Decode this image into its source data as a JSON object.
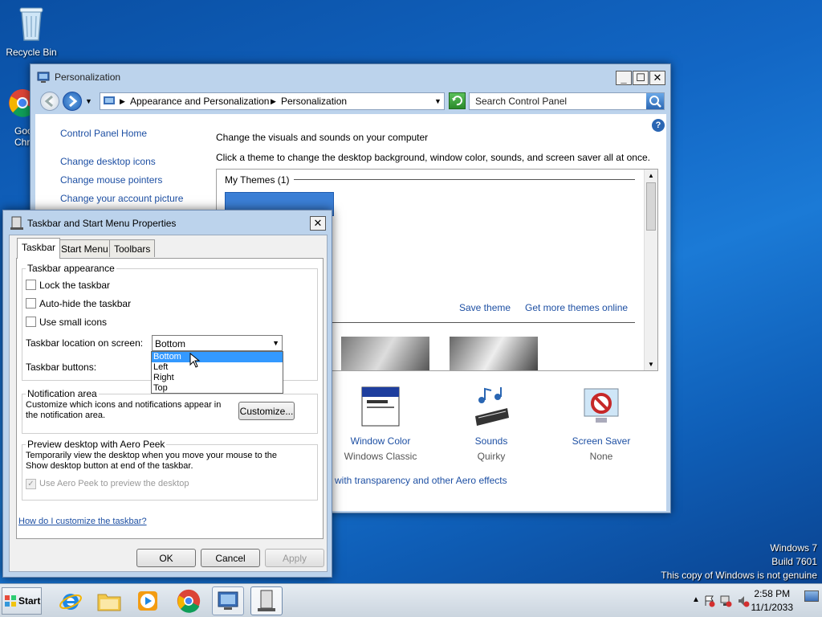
{
  "desktop": {
    "recycle_bin": "Recycle Bin",
    "chrome_partial_1": "Goo",
    "chrome_partial_2": "Chr",
    "watermark": [
      "Windows 7",
      "Build 7601",
      "This copy of Windows is not genuine"
    ]
  },
  "personalization": {
    "title": "Personalization",
    "breadcrumb": [
      "Appearance and Personalization",
      "Personalization"
    ],
    "search_placeholder": "Search Control Panel",
    "sidebar": {
      "home": "Control Panel Home",
      "links": [
        "Change desktop icons",
        "Change mouse pointers",
        "Change your account picture"
      ]
    },
    "heading": "Change the visuals and sounds on your computer",
    "subheading": "Click a theme to change the desktop background, window color, sounds, and screen saver all at once.",
    "my_themes": "My Themes (1)",
    "save_theme": "Save theme",
    "get_more": "Get more themes online",
    "bottom_items": [
      {
        "label": "Window Color",
        "sub": "Windows Classic"
      },
      {
        "label": "Sounds",
        "sub": "Quirky"
      },
      {
        "label": "Screen Saver",
        "sub": "None"
      }
    ],
    "aero_link": "with transparency and other Aero effects"
  },
  "dialog": {
    "title": "Taskbar and Start Menu Properties",
    "tabs": [
      "Taskbar",
      "Start Menu",
      "Toolbars"
    ],
    "appearance_group": "Taskbar appearance",
    "lock": "Lock the taskbar",
    "autohide": "Auto-hide the taskbar",
    "small_icons": "Use small icons",
    "location_label": "Taskbar location on screen:",
    "location_value": "Bottom",
    "location_options": [
      "Bottom",
      "Left",
      "Right",
      "Top"
    ],
    "buttons_label": "Taskbar buttons:",
    "notif_group": "Notification area",
    "notif_text": "Customize which icons and notifications appear in the notification area.",
    "customize": "Customize...",
    "peek_group": "Preview desktop with Aero Peek",
    "peek_text": "Temporarily view the desktop when you move your mouse to the Show desktop button at end of the taskbar.",
    "peek_check": "Use Aero Peek to preview the desktop",
    "help_link": "How do I customize the taskbar?",
    "ok": "OK",
    "cancel": "Cancel",
    "apply": "Apply"
  },
  "taskbar": {
    "start": "Start",
    "time": "2:58 PM",
    "date": "11/1/2033"
  }
}
